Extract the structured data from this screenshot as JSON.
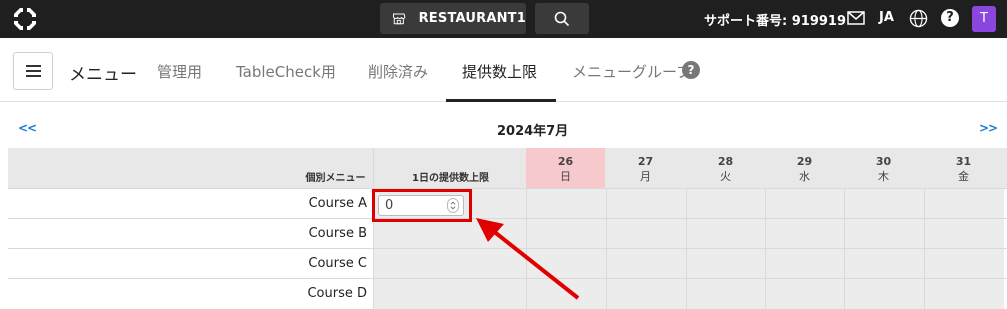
{
  "topbar": {
    "restaurant_label": "RESTAURANT1",
    "support_label": "サポート番号: 919919",
    "language": "JA",
    "help_symbol": "?",
    "avatar_initial": "T",
    "icons": [
      "logo-icon",
      "store-icon",
      "search-icon",
      "mail-icon",
      "globe-icon",
      "help-icon"
    ]
  },
  "page": {
    "title": "メニュー",
    "tabs": [
      {
        "label": "管理用",
        "active": false
      },
      {
        "label": "TableCheck用",
        "active": false
      },
      {
        "label": "削除済み",
        "active": false
      },
      {
        "label": "提供数上限",
        "active": true
      },
      {
        "label": "メニューグループ",
        "active": false
      }
    ],
    "tab_help_symbol": "?"
  },
  "calendar": {
    "prev_label": "<<",
    "next_label": ">>",
    "month_label": "2024年7月",
    "col_menu_label": "個別メニュー",
    "col_limit_label": "1日の提供数上限",
    "days": [
      {
        "date": "26",
        "weekday": "日",
        "today": true
      },
      {
        "date": "27",
        "weekday": "月",
        "today": false
      },
      {
        "date": "28",
        "weekday": "火",
        "today": false
      },
      {
        "date": "29",
        "weekday": "水",
        "today": false
      },
      {
        "date": "30",
        "weekday": "木",
        "today": false
      },
      {
        "date": "31",
        "weekday": "金",
        "today": false
      }
    ],
    "rows": [
      {
        "name": "Course A"
      },
      {
        "name": "Course B"
      },
      {
        "name": "Course C"
      },
      {
        "name": "Course D"
      }
    ],
    "daily_limit_value": "0"
  },
  "colors": {
    "topbar": "#1f1f1f",
    "accent_link": "#1a7bd6",
    "today_highlight": "#f6c9cc",
    "annotation_red": "#e00000",
    "avatar": "#8b46e0"
  }
}
